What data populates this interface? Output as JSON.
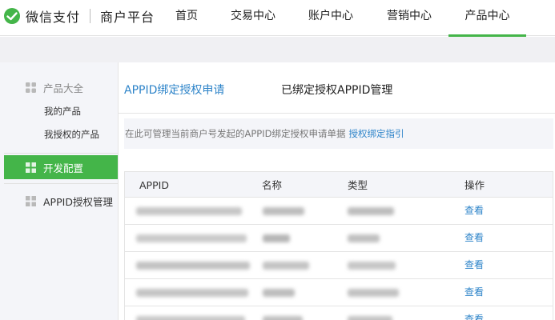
{
  "header": {
    "brand": "微信支付",
    "platform": "商户平台",
    "nav": [
      {
        "label": "首页",
        "active": false
      },
      {
        "label": "交易中心",
        "active": false
      },
      {
        "label": "账户中心",
        "active": false
      },
      {
        "label": "营销中心",
        "active": false
      },
      {
        "label": "产品中心",
        "active": true
      }
    ],
    "accent_color": "#44b549"
  },
  "sidebar": {
    "group_title": "产品大全",
    "sub_items": [
      "我的产品",
      "我授权的产品"
    ],
    "active_item": "开发配置",
    "items": [
      "APPID授权管理"
    ]
  },
  "main": {
    "tabs": [
      {
        "label": "APPID绑定授权申请",
        "active": true
      },
      {
        "label": "已绑定授权APPID管理",
        "active": false
      }
    ],
    "notice_text": "在此可管理当前商户号发起的APPID绑定授权申请单据",
    "notice_link": "授权绑定指引",
    "table": {
      "columns": [
        "APPID",
        "名称",
        "类型",
        "操作"
      ],
      "rows": [
        {
          "appid": "",
          "name": "",
          "type": "",
          "action": "查看"
        },
        {
          "appid": "",
          "name": "",
          "type": "",
          "action": "查看"
        },
        {
          "appid": "",
          "name": "",
          "type": "",
          "action": "查看"
        },
        {
          "appid": "",
          "name": "",
          "type": "",
          "action": "查看"
        },
        {
          "appid": "",
          "name": "",
          "type": "",
          "action": "查看"
        }
      ]
    }
  }
}
